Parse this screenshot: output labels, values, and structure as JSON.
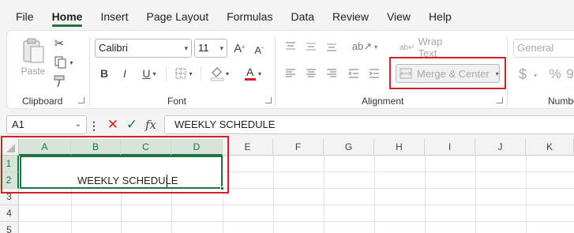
{
  "menu": {
    "tabs": [
      "File",
      "Home",
      "Insert",
      "Page Layout",
      "Formulas",
      "Data",
      "Review",
      "View",
      "Help"
    ],
    "active": "Home"
  },
  "ribbon": {
    "clipboard": {
      "paste_label": "Paste",
      "group_label": "Clipboard"
    },
    "font": {
      "font_name": "Calibri",
      "font_size": "11",
      "group_label": "Font",
      "bold": "B",
      "italic": "I",
      "underline": "U"
    },
    "alignment": {
      "wrap_text_label": "Wrap Text",
      "merge_center_label": "Merge & Center",
      "group_label": "Alignment"
    },
    "number": {
      "format": "General",
      "group_label": "Numbe"
    }
  },
  "formula_bar": {
    "name_box": "A1",
    "fx": "fx",
    "formula": "WEEKLY SCHEDULE"
  },
  "sheet": {
    "columns": [
      "A",
      "B",
      "C",
      "D",
      "E",
      "F",
      "G",
      "H",
      "I",
      "J",
      "K"
    ],
    "rows": [
      "1",
      "2",
      "3",
      "4",
      "5"
    ],
    "merged_cell_text": "WEEKLY SCHEDULE"
  },
  "colors": {
    "accent": "#217346",
    "highlight": "#d32027"
  }
}
